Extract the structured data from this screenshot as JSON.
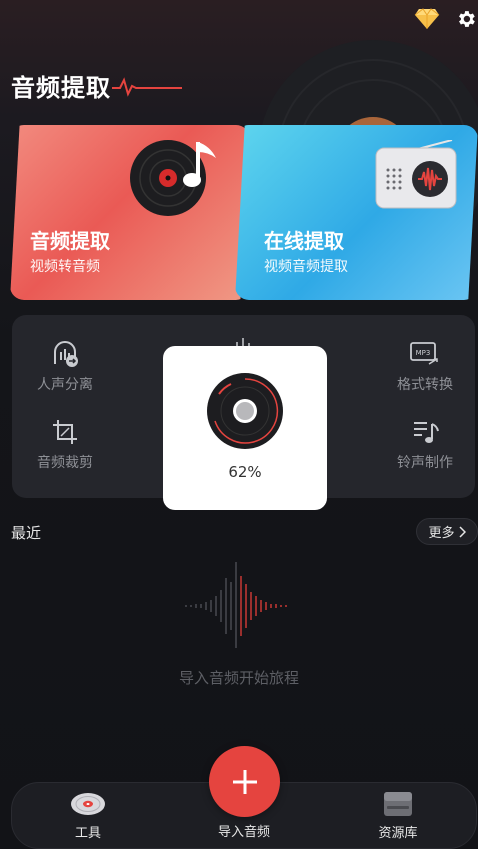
{
  "header": {
    "title": "音频提取",
    "icons": [
      "diamond-icon",
      "gear-icon"
    ]
  },
  "cards": [
    {
      "title": "音频提取",
      "subtitle": "视频转音频",
      "color": "#ea5a55"
    },
    {
      "title": "在线提取",
      "subtitle": "视频音频提取",
      "color": "#2fa9e6"
    }
  ],
  "tools": {
    "vocal_split": "人声分离",
    "format_convert": "格式转换",
    "audio_cut": "音频裁剪",
    "ringtone": "铃声制作"
  },
  "loading": {
    "percent": "62%"
  },
  "recent": {
    "label": "最近",
    "more": "更多",
    "empty_text": "导入音频开始旅程"
  },
  "nav": {
    "tools": "工具",
    "import": "导入音频",
    "library": "资源库"
  },
  "colors": {
    "accent": "#e5443f",
    "background": "#141519"
  }
}
